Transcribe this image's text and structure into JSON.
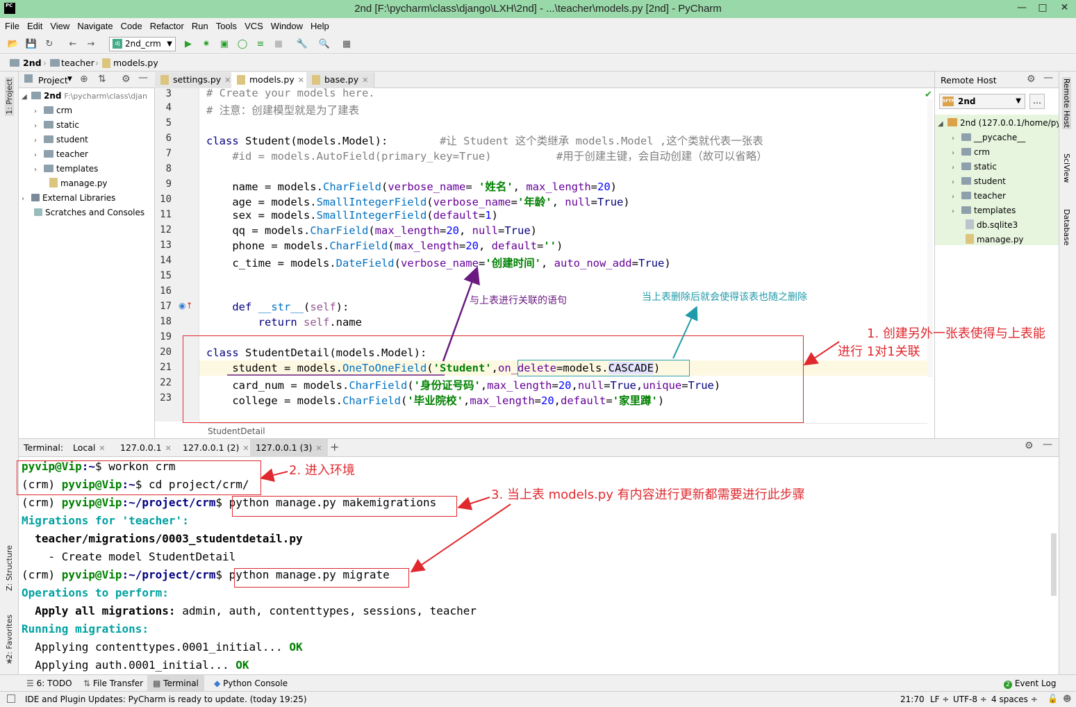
{
  "window": {
    "title": "2nd [F:\\pycharm\\class\\django\\LXH\\2nd] - ...\\teacher\\models.py [2nd] - PyCharm",
    "app_icon": "PC"
  },
  "menu": [
    "File",
    "Edit",
    "View",
    "Navigate",
    "Code",
    "Refactor",
    "Run",
    "Tools",
    "VCS",
    "Window",
    "Help"
  ],
  "toolbar": {
    "run_config": "2nd_crm"
  },
  "breadcrumb": [
    "2nd",
    "teacher",
    "models.py"
  ],
  "project": {
    "header": "Project",
    "root_name": "2nd",
    "root_path": "F:\\pycharm\\class\\djan",
    "items": [
      "crm",
      "static",
      "student",
      "teacher",
      "templates",
      "manage.py",
      "External Libraries",
      "Scratches and Consoles"
    ]
  },
  "tabs": [
    "settings.py",
    "models.py",
    "base.py"
  ],
  "editor": {
    "line_numbers": [
      "3",
      "4",
      "5",
      "6",
      "7",
      "8",
      "9",
      "10",
      "11",
      "12",
      "13",
      "14",
      "15",
      "16",
      "17",
      "18",
      "19",
      "20",
      "21",
      "22",
      "23"
    ],
    "lines": {
      "l3": "# Create your models here.",
      "l4": "# 注意：创建模型就是为了建表",
      "l6a": "class ",
      "l6b": "Student(models.Model):",
      "l6c": "        #让 Student 这个类继承 models.Model ,这个类就代表一张表",
      "l7a": "    #id = models.AutoField(primary_key=True)",
      "l7b": "          #用于创建主键，会自动创建（故可以省略）",
      "l9a": "    name = models.",
      "l9b": "CharField",
      "l9c": "(",
      "l9d": "verbose_name",
      "l9e": "= ",
      "l9f": "'姓名'",
      "l9g": ", ",
      "l9h": "max_length",
      "l9i": "=",
      "l9j": "20",
      "l9k": ")",
      "l10a": "    age = models.",
      "l10b": "SmallIntegerField",
      "l10c": "(",
      "l10d": "verbose_name",
      "l10e": "=",
      "l10f": "'年龄'",
      "l10g": ", ",
      "l10h": "null",
      "l10i": "=",
      "l10j": "True",
      "l10k": ")",
      "l11a": "    sex = models.",
      "l11b": "SmallIntegerField",
      "l11c": "(",
      "l11d": "default",
      "l11e": "=",
      "l11f": "1",
      "l11g": ")",
      "l12a": "    qq = models.",
      "l12b": "CharField",
      "l12c": "(",
      "l12d": "max_length",
      "l12e": "=",
      "l12f": "20",
      "l12g": ", ",
      "l12h": "null",
      "l12i": "=",
      "l12j": "True",
      "l12k": ")",
      "l13a": "    phone = models.",
      "l13b": "CharField",
      "l13c": "(",
      "l13d": "max_length",
      "l13e": "=",
      "l13f": "20",
      "l13g": ", ",
      "l13h": "default",
      "l13i": "=",
      "l13j": "''",
      "l13k": ")",
      "l14a": "    c_time = models.",
      "l14b": "DateField",
      "l14c": "(",
      "l14d": "verbose_name",
      "l14e": "=",
      "l14f": "'创建时间'",
      "l14g": ", ",
      "l14h": "auto_now_add",
      "l14i": "=",
      "l14j": "True",
      "l14k": ")",
      "l17a": "    def ",
      "l17b": "__str__",
      "l17c": "(",
      "l17d": "self",
      "l17e": "):",
      "l18a": "        return ",
      "l18b": "self",
      "l18c": ".name",
      "l20a": "class ",
      "l20b": "StudentDetail(models.Model):",
      "l21a": "    student = models.",
      "l21b": "OneToOneField",
      "l21c": "(",
      "l21d": "'Student'",
      "l21e": ",",
      "l21f": "on_delete",
      "l21g": "=models.",
      "l21h": "CASCADE",
      "l21i": ")",
      "l22a": "    card_num = models.",
      "l22b": "CharField",
      "l22c": "(",
      "l22d": "'身份证号码'",
      "l22e": ",",
      "l22f": "max_length",
      "l22g": "=",
      "l22h": "20",
      "l22i": ",",
      "l22j": "null",
      "l22k": "=",
      "l22l": "True",
      "l22m": ",",
      "l22n": "unique",
      "l22o": "=",
      "l22p": "True",
      "l22q": ")",
      "l23a": "    college = models.",
      "l23b": "CharField",
      "l23c": "(",
      "l23d": "'毕业院校'",
      "l23e": ",",
      "l23f": "max_length",
      "l23g": "=",
      "l23h": "20",
      "l23i": ",",
      "l23j": "default",
      "l23k": "=",
      "l23l": "'家里蹲'",
      "l23m": ")"
    },
    "status_context": "StudentDetail"
  },
  "remote": {
    "header": "Remote Host",
    "server": "2nd",
    "root": "2nd (127.0.0.1/home/py",
    "items": [
      "__pycache__",
      "crm",
      "static",
      "student",
      "teacher",
      "templates",
      "db.sqlite3",
      "manage.py"
    ]
  },
  "right_stripe": [
    "Remote Host",
    "SciView",
    "Database"
  ],
  "left_stripe": [
    "1: Project",
    "Z: Structure",
    "2: Favorites"
  ],
  "terminal": {
    "label": "Terminal:",
    "tabs": [
      "Local",
      "127.0.0.1",
      "127.0.0.1 (2)",
      "127.0.0.1 (3)"
    ],
    "lines": {
      "t1a": "pyvip@Vip",
      "t1b": ":~",
      "t1c": "$ workon crm",
      "t2a": "(crm) ",
      "t2b": "pyvip@Vip",
      "t2c": ":~",
      "t2d": "$ cd project/crm/",
      "t3a": "(crm) ",
      "t3b": "pyvip@Vip",
      "t3c": ":~/project/crm",
      "t3d": "$ python manage.py makemigrations",
      "t4": "Migrations for 'teacher':",
      "t5": "  teacher/migrations/0003_studentdetail.py",
      "t6": "    - Create model StudentDetail",
      "t7a": "(crm) ",
      "t7b": "pyvip@Vip",
      "t7c": ":~/project/crm",
      "t7d": "$ python manage.py migrate",
      "t8": "Operations to perform:",
      "t9a": "  Apply all migrations: ",
      "t9b": "admin, auth, contenttypes, sessions, teacher",
      "t10": "Running migrations:",
      "t11a": "  Applying contenttypes.0001_initial... ",
      "t11b": "OK",
      "t12a": "  Applying auth.0001_initial... ",
      "t12b": "OK"
    }
  },
  "bottom_tabs": [
    "6: TODO",
    "File Transfer",
    "Terminal",
    "Python Console"
  ],
  "event_log": {
    "count": "2",
    "label": "Event Log"
  },
  "status": {
    "message": "IDE and Plugin Updates: PyCharm is ready to update. (today 19:25)",
    "position": "21:70",
    "line_sep": "LF ÷",
    "encoding": "UTF-8 ÷",
    "indent": "4 spaces ÷"
  },
  "annotations": {
    "a1_line1": "1. 创建另外一张表使得与上表能",
    "a1_line2": "进行 1对1关联",
    "a2": "2. 进入环境",
    "a3": "3. 当上表 models.py 有内容进行更新都需要进行此步骤",
    "purple": "与上表进行关联的语句",
    "teal": "当上表删除后就会使得该表也随之删除"
  },
  "colors": {
    "titlebar": "#99d8a8",
    "annotation_red": "#e0282e",
    "annotation_purple": "#6a1a80",
    "annotation_teal": "#1f9aa8",
    "remote_highlight": "#e7f5df"
  }
}
